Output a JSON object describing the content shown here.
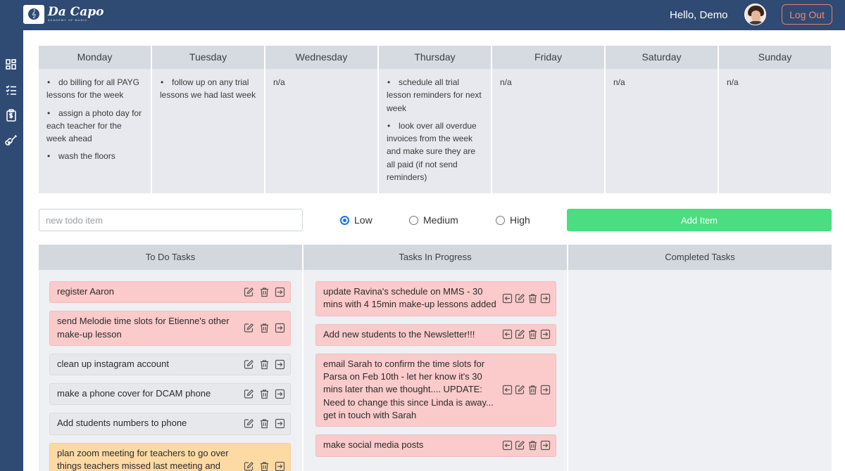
{
  "header": {
    "brand": "Da Capo",
    "tagline": "ACADEMY OF MUSIC",
    "greeting": "Hello, Demo",
    "logout_label": "Log Out",
    "bg_color": "#2f4a73"
  },
  "sidebar": {
    "icons": [
      "dashboard-icon",
      "checklist-icon",
      "invoice-icon",
      "guitar-icon"
    ]
  },
  "week": {
    "days": [
      {
        "name": "Monday",
        "items": [
          "do billing for all PAYG lessons for the week",
          "assign a photo day for each teacher for the week ahead",
          "wash the floors"
        ]
      },
      {
        "name": "Tuesday",
        "items": [
          "follow up on any trial lessons we had last week"
        ]
      },
      {
        "name": "Wednesday",
        "text": "n/a"
      },
      {
        "name": "Thursday",
        "items": [
          "schedule all trial lesson reminders for next week",
          "look over all overdue invoices from the week and make sure they are all paid (if not send reminders)"
        ]
      },
      {
        "name": "Friday",
        "text": "n/a"
      },
      {
        "name": "Saturday",
        "text": "n/a"
      },
      {
        "name": "Sunday",
        "text": "n/a"
      }
    ]
  },
  "form": {
    "placeholder": "new todo item",
    "priorities": [
      "Low",
      "Medium",
      "High"
    ],
    "selected_priority": "Low",
    "add_label": "Add Item",
    "add_color": "#4ade80"
  },
  "board": {
    "todo_title": "To Do Tasks",
    "progress_title": "Tasks In Progress",
    "completed_title": "Completed Tasks",
    "priority_colors": {
      "high": "#fbcaca",
      "low": "#e6e8ec",
      "medium": "#fdd9a4"
    },
    "todo": [
      {
        "text": "register Aaron",
        "priority": "high"
      },
      {
        "text": "send Melodie time slots for Etienne's other make-up lesson",
        "priority": "high"
      },
      {
        "text": "clean up instagram account",
        "priority": "low"
      },
      {
        "text": "make a phone cover for DCAM phone",
        "priority": "low"
      },
      {
        "text": "Add students numbers to phone",
        "priority": "low"
      },
      {
        "text": "plan zoom meeting for teachers to go over things teachers missed last meeting and main topics for new teachers",
        "priority": "medium"
      }
    ],
    "progress": [
      {
        "text": "update Ravina's schedule on MMS - 30 mins with 4 15min make-up lessons added",
        "priority": "high"
      },
      {
        "text": "Add new students to the Newsletter!!!",
        "priority": "high"
      },
      {
        "text": "email Sarah to confirm the time slots for Parsa on Feb 10th - let her know it's 30 mins later than we thought.... UPDATE: Need to change this since Linda is away... get in touch with Sarah",
        "priority": "high"
      },
      {
        "text": "make social media posts",
        "priority": "high"
      }
    ],
    "completed": []
  }
}
